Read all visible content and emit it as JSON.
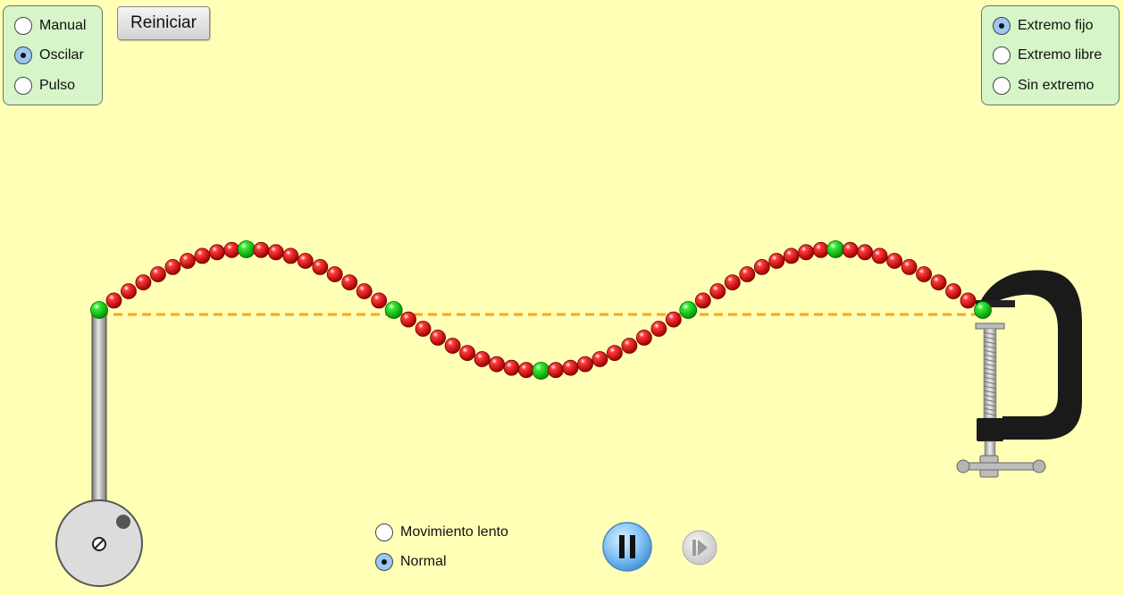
{
  "mode_options": [
    {
      "label": "Manual",
      "selected": false
    },
    {
      "label": "Oscilar",
      "selected": true
    },
    {
      "label": "Pulso",
      "selected": false
    }
  ],
  "reset_label": "Reiniciar",
  "end_options": [
    {
      "label": "Extremo fijo",
      "selected": true
    },
    {
      "label": "Extremo libre",
      "selected": false
    },
    {
      "label": "Sin extremo",
      "selected": false
    }
  ],
  "speed_options": [
    {
      "label": "Movimiento lento",
      "selected": false
    },
    {
      "label": "Normal",
      "selected": true
    }
  ],
  "playback": {
    "state": "playing",
    "pause_icon": "pause-icon",
    "step_icon": "step-icon",
    "step_enabled": false
  },
  "colors": {
    "background": "#ffffb5",
    "panel": "#d6f5c8",
    "bead": "#e00000",
    "marker_bead": "#22dd22",
    "equilibrium_line": "#f5a623",
    "play_button": "#7fc0f5"
  },
  "string": {
    "bead_count": 61,
    "marker_every": 10,
    "wave_amplitude_fraction": 0.5
  }
}
